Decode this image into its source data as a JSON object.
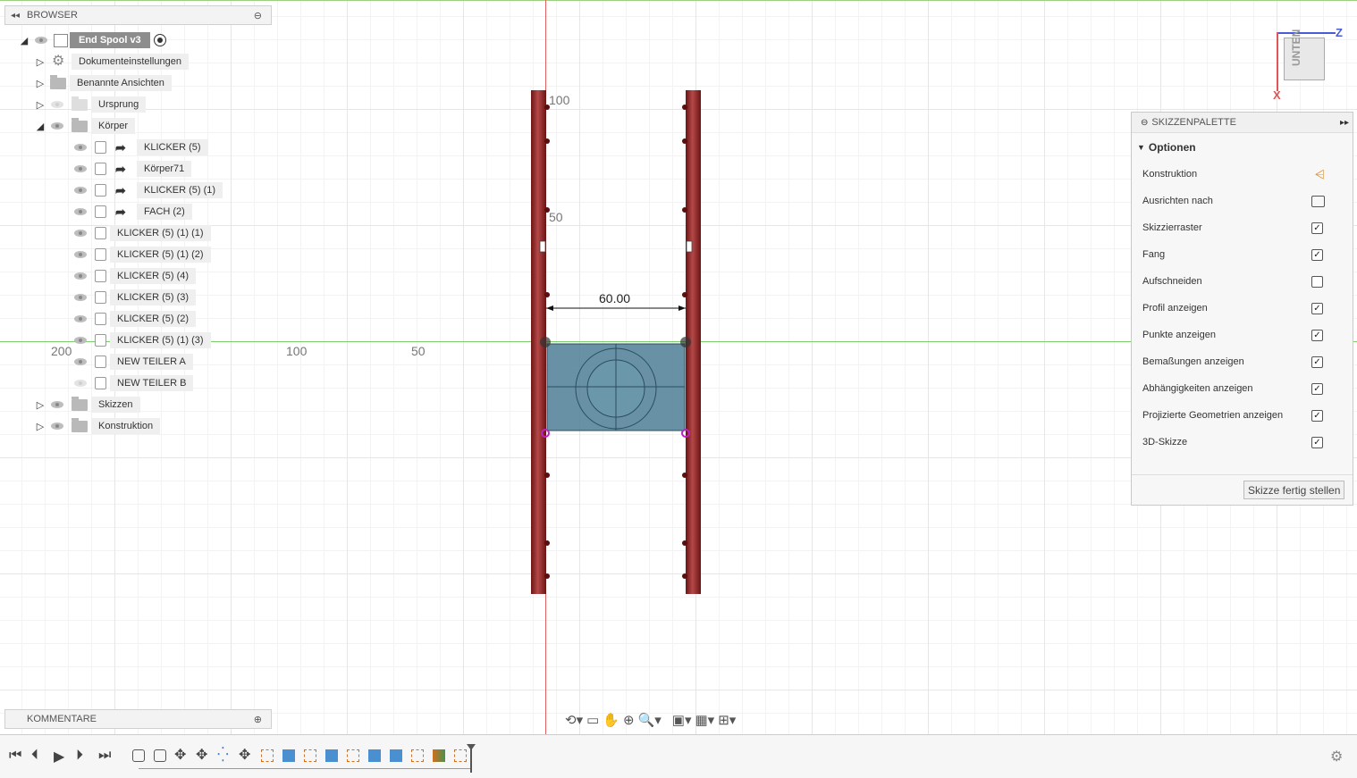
{
  "browser": {
    "title": "BROWSER",
    "root": "End Spool v3",
    "items": [
      {
        "label": "Dokumenteinstellungen"
      },
      {
        "label": "Benannte Ansichten"
      },
      {
        "label": "Ursprung"
      },
      {
        "label": "Körper"
      },
      {
        "label": "KLICKER (5)"
      },
      {
        "label": "Körper71"
      },
      {
        "label": "KLICKER (5) (1)"
      },
      {
        "label": "FACH (2)"
      },
      {
        "label": "KLICKER (5) (1) (1)"
      },
      {
        "label": "KLICKER (5) (1) (2)"
      },
      {
        "label": "KLICKER (5) (4)"
      },
      {
        "label": "KLICKER (5) (3)"
      },
      {
        "label": "KLICKER (5) (2)"
      },
      {
        "label": "KLICKER (5) (1) (3)"
      },
      {
        "label": "NEW TEILER A"
      },
      {
        "label": "NEW TEILER B"
      },
      {
        "label": "Skizzen"
      },
      {
        "label": "Konstruktion"
      }
    ]
  },
  "comments": {
    "title": "KOMMENTARE"
  },
  "viewport": {
    "axis_labels": [
      "200",
      "100",
      "50"
    ],
    "vertical_labels": [
      "100",
      "50"
    ],
    "dimension": "60.00",
    "viewcube_face": "UNTEN",
    "axis_z": "Z",
    "axis_x": "X"
  },
  "palette": {
    "title": "SKIZZENPALETTE",
    "section": "Optionen",
    "rows": [
      {
        "label": "Konstruktion",
        "control": "icon"
      },
      {
        "label": "Ausrichten nach",
        "control": "icon"
      },
      {
        "label": "Skizzierraster",
        "checked": "✓"
      },
      {
        "label": "Fang",
        "checked": "✓"
      },
      {
        "label": "Aufschneiden",
        "checked": ""
      },
      {
        "label": "Profil anzeigen",
        "checked": "✓"
      },
      {
        "label": "Punkte anzeigen",
        "checked": "✓"
      },
      {
        "label": "Bemaßungen anzeigen",
        "checked": "✓"
      },
      {
        "label": "Abhängigkeiten anzeigen",
        "checked": "✓"
      },
      {
        "label": "Projizierte Geometrien anzeigen",
        "checked": "✓"
      },
      {
        "label": "3D-Skizze",
        "checked": "✓"
      }
    ],
    "finish_button": "Skizze fertig stellen"
  },
  "colors": {
    "accent_red": "#8b1e1e",
    "body_blue": "#4e7e96",
    "axis_red": "#e06060",
    "axis_green": "#7ccf6a"
  }
}
